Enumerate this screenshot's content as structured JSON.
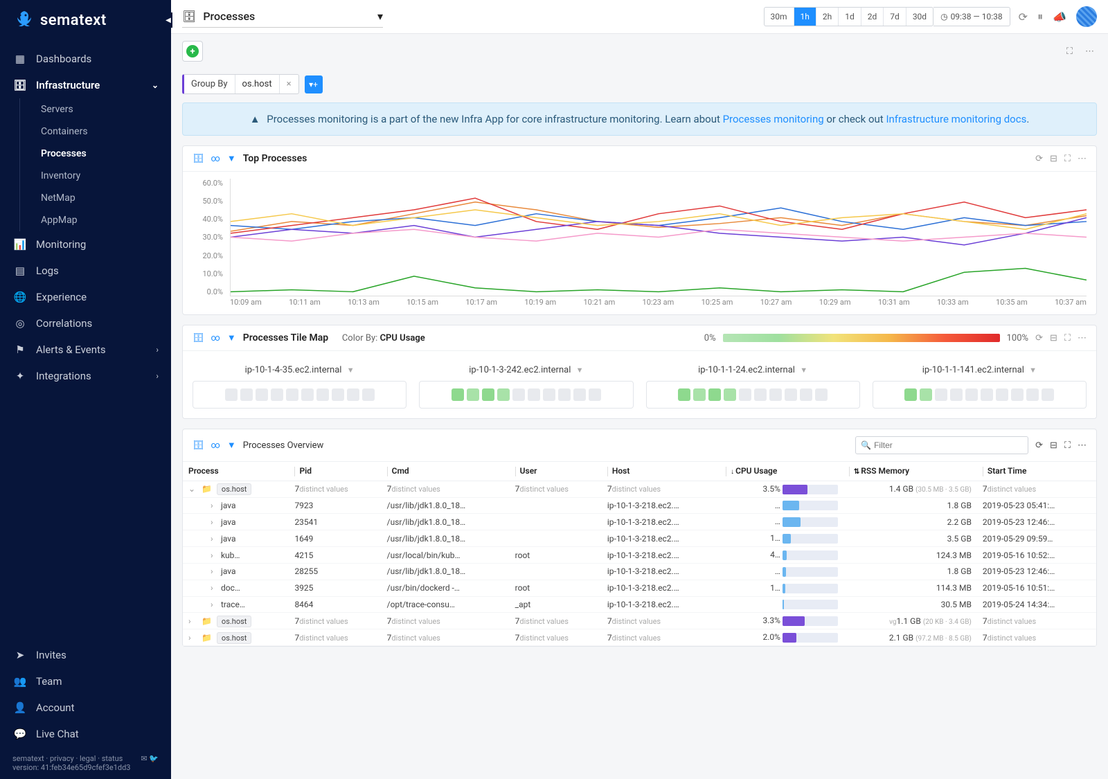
{
  "brand": "sematext",
  "sidebar": {
    "items": [
      {
        "label": "Dashboards",
        "icon": "dashboard"
      },
      {
        "label": "Infrastructure",
        "icon": "infra",
        "expanded": true,
        "active": true,
        "children": [
          {
            "label": "Servers"
          },
          {
            "label": "Containers"
          },
          {
            "label": "Processes",
            "active": true
          },
          {
            "label": "Inventory"
          },
          {
            "label": "NetMap"
          },
          {
            "label": "AppMap"
          }
        ]
      },
      {
        "label": "Monitoring",
        "icon": "chart"
      },
      {
        "label": "Logs",
        "icon": "logs"
      },
      {
        "label": "Experience",
        "icon": "globe"
      },
      {
        "label": "Correlations",
        "icon": "target"
      },
      {
        "label": "Alerts & Events",
        "icon": "flag",
        "chev": true
      },
      {
        "label": "Integrations",
        "icon": "puzzle",
        "chev": true
      }
    ],
    "bottom": [
      {
        "label": "Invites",
        "icon": "send"
      },
      {
        "label": "Team",
        "icon": "team"
      },
      {
        "label": "Account",
        "icon": "user"
      },
      {
        "label": "Live Chat",
        "icon": "chat"
      }
    ],
    "footer_links": "sematext · privacy · legal · status",
    "footer_version": "version: 41:feb34e65d9cfef3e1dd3"
  },
  "topbar": {
    "app_name": "Processes",
    "ranges": [
      "30m",
      "1h",
      "2h",
      "1d",
      "2d",
      "7d",
      "30d"
    ],
    "range_selected": "1h",
    "abs_range": "09:38 — 10:38"
  },
  "filter": {
    "groupby_label": "Group By",
    "groupby_value": "os.host"
  },
  "banner": {
    "text_pre": "Processes monitoring is a part of the new Infra App for core infrastructure monitoring. Learn about ",
    "link1": "Processes monitoring",
    "text_mid": " or check out ",
    "link2": "Infrastructure monitoring docs",
    "text_post": "."
  },
  "chart_data": {
    "type": "line",
    "title": "Top Processes",
    "ylabel": "",
    "ylim": [
      0,
      60
    ],
    "yticks": [
      "60.0%",
      "50.0%",
      "40.0%",
      "30.0%",
      "20.0%",
      "10.0%",
      "0.0%"
    ],
    "x": [
      "10:09 am",
      "10:11 am",
      "10:13 am",
      "10:15 am",
      "10:17 am",
      "10:19 am",
      "10:21 am",
      "10:23 am",
      "10:25 am",
      "10:27 am",
      "10:29 am",
      "10:31 am",
      "10:33 am",
      "10:35 am",
      "10:37 am"
    ],
    "series": [
      {
        "name": "s1",
        "color": "#e8893a",
        "values": [
          33,
          38,
          36,
          42,
          48,
          44,
          38,
          35,
          37,
          40,
          36,
          42,
          38,
          36,
          41
        ]
      },
      {
        "name": "s2",
        "color": "#2b6fd6",
        "values": [
          36,
          34,
          38,
          40,
          36,
          42,
          38,
          36,
          40,
          45,
          38,
          34,
          40,
          36,
          38
        ]
      },
      {
        "name": "s3",
        "color": "#e03a3a",
        "values": [
          32,
          36,
          40,
          44,
          50,
          38,
          34,
          42,
          46,
          38,
          34,
          42,
          48,
          40,
          44
        ]
      },
      {
        "name": "s4",
        "color": "#6b3fd6",
        "values": [
          30,
          34,
          32,
          36,
          30,
          34,
          38,
          36,
          32,
          30,
          28,
          30,
          26,
          32,
          40
        ]
      },
      {
        "name": "s5",
        "color": "#f5c84a",
        "values": [
          38,
          42,
          36,
          40,
          44,
          40,
          36,
          38,
          42,
          36,
          40,
          42,
          38,
          34,
          42
        ]
      },
      {
        "name": "s6",
        "color": "#f59aca",
        "values": [
          30,
          28,
          32,
          34,
          30,
          28,
          32,
          30,
          34,
          32,
          30,
          28,
          30,
          32,
          30
        ]
      },
      {
        "name": "s7",
        "color": "#28a428",
        "values": [
          2,
          3,
          2,
          10,
          4,
          2,
          3,
          2,
          4,
          2,
          3,
          2,
          12,
          14,
          8
        ]
      }
    ]
  },
  "tilemap": {
    "title": "Processes Tile Map",
    "colorby_label": "Color By:",
    "colorby_value": "CPU Usage",
    "legend_min": "0%",
    "legend_max": "100%",
    "hosts": [
      {
        "name": "ip-10-1-4-35.ec2.internal",
        "greens": 0
      },
      {
        "name": "ip-10-1-3-242.ec2.internal",
        "greens": 4
      },
      {
        "name": "ip-10-1-1-24.ec2.internal",
        "greens": 4
      },
      {
        "name": "ip-10-1-1-141.ec2.internal",
        "greens": 2
      }
    ]
  },
  "overview": {
    "title": "Processes Overview",
    "filter_placeholder": "Filter",
    "columns": [
      "Process",
      "Pid",
      "Cmd",
      "User",
      "Host",
      "CPU Usage",
      "RSS Memory",
      "Start Time"
    ],
    "rows": [
      {
        "type": "group",
        "host": "os.host",
        "pid": "7",
        "pid_unit": "distinct values",
        "cmd": "7",
        "cmd_unit": "distinct values",
        "user": "7",
        "user_unit": "distinct values",
        "hostv": "7",
        "host_unit": "distinct values",
        "cpu": "3.5%",
        "cpu_fill": 45,
        "cpu_purple": true,
        "mem": "1.4 GB",
        "memsub": "(30.5 MB · 3.5 GB)",
        "start": "7",
        "start_unit": "distinct values",
        "expanded": true
      },
      {
        "type": "row",
        "proc": "java",
        "pid": "7923",
        "cmd": "/usr/lib/jdk1.8.0_18…",
        "user": "",
        "host": "ip-10-1-3-218.ec2.…",
        "cpu": "…",
        "cpu_fill": 30,
        "mem": "1.8 GB",
        "start": "2019-05-23 05:41:…"
      },
      {
        "type": "row",
        "proc": "java",
        "pid": "23541",
        "cmd": "/usr/lib/jdk1.8.0_18…",
        "user": "",
        "host": "ip-10-1-3-218.ec2.…",
        "cpu": "…",
        "cpu_fill": 32,
        "mem": "2.2 GB",
        "start": "2019-05-23 12:46:…"
      },
      {
        "type": "row",
        "proc": "java",
        "pid": "1649",
        "cmd": "/usr/lib/jdk1.8.0_18…",
        "user": "",
        "host": "ip-10-1-3-218.ec2.…",
        "cpu": "1…",
        "cpu_fill": 15,
        "mem": "3.5 GB",
        "start": "2019-05-29 09:59…"
      },
      {
        "type": "row",
        "proc": "kub…",
        "pid": "4215",
        "cmd": "/usr/local/bin/kub…",
        "user": "root",
        "host": "ip-10-1-3-218.ec2.…",
        "cpu": "4…",
        "cpu_fill": 8,
        "mem": "124.3 MB",
        "start": "2019-05-16 10:52:…"
      },
      {
        "type": "row",
        "proc": "java",
        "pid": "28255",
        "cmd": "/usr/lib/jdk1.8.0_18…",
        "user": "",
        "host": "ip-10-1-3-218.ec2.…",
        "cpu": "…",
        "cpu_fill": 6,
        "mem": "1.8 GB",
        "start": "2019-05-23 12:46:…"
      },
      {
        "type": "row",
        "proc": "doc…",
        "pid": "3925",
        "cmd": "/usr/bin/dockerd -…",
        "user": "root",
        "host": "ip-10-1-3-218.ec2.…",
        "cpu": "1…",
        "cpu_fill": 5,
        "mem": "114.3 MB",
        "start": "2019-05-16 10:51:…"
      },
      {
        "type": "row",
        "proc": "trace…",
        "pid": "8464",
        "cmd": "/opt/trace-consu…",
        "user": "_apt",
        "host": "ip-10-1-3-218.ec2.…",
        "cpu": "",
        "cpu_fill": 3,
        "mem": "30.5 MB",
        "start": "2019-05-24 14:34:…"
      },
      {
        "type": "group",
        "host": "os.host",
        "pid": "7",
        "pid_unit": "distinct values",
        "cmd": "7",
        "cmd_unit": "distinct values",
        "user": "7",
        "user_unit": "distinct values",
        "hostv": "7",
        "host_unit": "distinct values",
        "cpu": "3.3%",
        "cpu_fill": 40,
        "cpu_purple": true,
        "mem": "1.1 GB",
        "mempre": "vg",
        "memsub": "(20 KB · 3.4 GB)",
        "start": "7",
        "start_unit": "distinct values"
      },
      {
        "type": "group",
        "host": "os.host",
        "pid": "7",
        "pid_unit": "distinct values",
        "cmd": "7",
        "cmd_unit": "distinct values",
        "user": "7",
        "user_unit": "distinct values",
        "hostv": "7",
        "host_unit": "distinct values",
        "cpu": "2.0%",
        "cpu_fill": 25,
        "cpu_purple": true,
        "mem": "2.1 GB",
        "memsub": "(97.2 MB · 8.5 GB)",
        "start": "7",
        "start_unit": "distinct values"
      }
    ]
  }
}
